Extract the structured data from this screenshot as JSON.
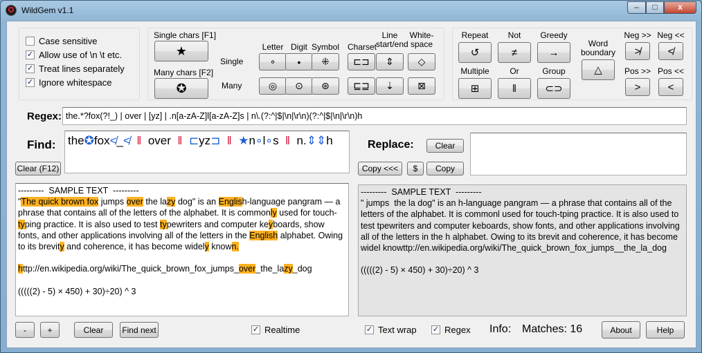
{
  "window": {
    "title": "WildGem v1.1",
    "app_icon": "✪"
  },
  "caption": {
    "minimize": "–",
    "maximize": "□",
    "close": "x"
  },
  "options": [
    {
      "label": "Case sensitive",
      "checked": false
    },
    {
      "label": "Allow use of \\n \\t etc.",
      "checked": true
    },
    {
      "label": "Treat lines separately",
      "checked": true
    },
    {
      "label": "Ignore whitespace",
      "checked": true
    }
  ],
  "chars": {
    "single_label": "Single chars [F1]",
    "single_glyph": "★",
    "many_label": "Many chars [F2]",
    "many_glyph": "✪",
    "row_single": "Single",
    "row_many": "Many",
    "columns": [
      {
        "label": "Letter",
        "single": "∘",
        "many": "◎"
      },
      {
        "label": "Digit",
        "single": "•",
        "many": "⊙"
      },
      {
        "label": "Symbol",
        "single": "⁜",
        "many": "⊛"
      },
      {
        "label": "Charset",
        "single": "⊏⊐",
        "many": "⊑⊒"
      },
      {
        "label": "Line\nstart/end",
        "single": "⇕",
        "many": "⇣"
      },
      {
        "label": "White-\nspace",
        "single": "◇",
        "many": "⊠"
      }
    ]
  },
  "ops": {
    "repeat": {
      "label": "Repeat",
      "glyph": "↺"
    },
    "not": {
      "label": "Not",
      "glyph": "≠"
    },
    "greedy": {
      "label": "Greedy",
      "glyph": "→"
    },
    "multiple": {
      "label": "Multiple",
      "glyph": "⊞"
    },
    "or": {
      "label": "Or",
      "glyph": "‖"
    },
    "group": {
      "label": "Group",
      "glyph": "⊂⊃"
    },
    "word_boundary": {
      "label": "Word\nboundary",
      "glyph": "△"
    },
    "neg_ahead": {
      "label": "Neg >>",
      "glyph": "≯"
    },
    "neg_behind": {
      "label": "Neg <<",
      "glyph": "≮"
    },
    "pos_ahead": {
      "label": "Pos >>",
      "glyph": ">"
    },
    "pos_behind": {
      "label": "Pos <<",
      "glyph": "<"
    }
  },
  "regex": {
    "label": "Regex:",
    "value": "the.*?fox(?!_)  |  over  |  [yz]  |  .n[a-zA-Z]l[a-zA-Z]s  |  n\\.(?:^|$|\\n|\\r\\n)(?:^|$|\\n|\\r\\n)h"
  },
  "find": {
    "label": "Find:",
    "clear_button": "Clear (F12)",
    "tokens": [
      {
        "text": "the",
        "cls": ""
      },
      {
        "text": "✪",
        "cls": "fk"
      },
      {
        "text": "fox",
        "cls": ""
      },
      {
        "text": "≮",
        "cls": "fk"
      },
      {
        "text": "_",
        "cls": ""
      },
      {
        "text": "≮",
        "cls": "fk"
      },
      {
        "text": "  ‖  ",
        "cls": "fr"
      },
      {
        "text": "over",
        "cls": ""
      },
      {
        "text": "  ‖  ",
        "cls": "fr"
      },
      {
        "text": "⊏",
        "cls": "fk"
      },
      {
        "text": "yz",
        "cls": ""
      },
      {
        "text": "⊐",
        "cls": "fk"
      },
      {
        "text": "  ‖  ",
        "cls": "fr"
      },
      {
        "text": "★",
        "cls": "fk"
      },
      {
        "text": "n",
        "cls": ""
      },
      {
        "text": "∘",
        "cls": "fk"
      },
      {
        "text": "l",
        "cls": ""
      },
      {
        "text": "∘",
        "cls": "fk"
      },
      {
        "text": "s",
        "cls": ""
      },
      {
        "text": "  ‖  ",
        "cls": "fr"
      },
      {
        "text": "n.",
        "cls": ""
      },
      {
        "text": "⇕⇕",
        "cls": "fk"
      },
      {
        "text": "h",
        "cls": ""
      }
    ]
  },
  "replace": {
    "label": "Replace:",
    "clear": "Clear",
    "copy_from": "Copy <<<",
    "dollar": "$",
    "copy": "Copy",
    "value": ""
  },
  "sample_left": [
    {
      "text": "---------  SAMPLE TEXT  ---------\n\"",
      "hl": false
    },
    {
      "text": "The quick brown fox",
      "hl": true
    },
    {
      "text": " jumps ",
      "hl": false
    },
    {
      "text": "over",
      "hl": true
    },
    {
      "text": " the la",
      "hl": false
    },
    {
      "text": "zy",
      "hl": true
    },
    {
      "text": " dog\" is an ",
      "hl": false
    },
    {
      "text": "Englis",
      "hl": true
    },
    {
      "text": "h-language pangram — a phrase that contains all of the letters of the alphabet. It is common",
      "hl": false
    },
    {
      "text": "ly",
      "hl": true
    },
    {
      "text": " used for touch-",
      "hl": false
    },
    {
      "text": "ty",
      "hl": true
    },
    {
      "text": "ping practice. It is also used to test ",
      "hl": false
    },
    {
      "text": "ty",
      "hl": true
    },
    {
      "text": "pewriters and computer ke",
      "hl": false
    },
    {
      "text": "y",
      "hl": true
    },
    {
      "text": "boards, show fonts, and other applications involving all of the letters in the ",
      "hl": false
    },
    {
      "text": "English",
      "hl": true
    },
    {
      "text": " alphabet. Owing to its brevit",
      "hl": false
    },
    {
      "text": "y",
      "hl": true
    },
    {
      "text": " and coherence, it has become widel",
      "hl": false
    },
    {
      "text": "y",
      "hl": true
    },
    {
      "text": " know",
      "hl": false
    },
    {
      "text": "n.",
      "hl": true
    },
    {
      "text": "\n\n",
      "hl": false
    },
    {
      "text": "h",
      "hl": true
    },
    {
      "text": "ttp://en.wikipedia.org/wiki/The_quick_brown_fox_jumps_",
      "hl": false
    },
    {
      "text": "over",
      "hl": true
    },
    {
      "text": "_the_la",
      "hl": false
    },
    {
      "text": "zy",
      "hl": true
    },
    {
      "text": "_dog\n\n(((((2) - 5) × 450) + 30)÷20) ^ 3",
      "hl": false
    }
  ],
  "sample_right": "---------  SAMPLE TEXT  ---------\n\" jumps  the la dog\" is an h-language pangram — a phrase that contains all of the letters of the alphabet. It is commonl used for touch-tping practice. It is also used to test tpewriters and computer keboards, show fonts, and other applications involving all of the letters in the h alphabet. Owing to its brevit and coherence, it has become widel knowttp://en.wikipedia.org/wiki/The_quick_brown_fox_jumps__the_la_dog\n\n(((((2) - 5) × 450) + 30)÷20) ^ 3",
  "bottom": {
    "minus": "-",
    "plus": "+",
    "clear": "Clear",
    "find_next": "Find next",
    "realtime": {
      "label": "Realtime",
      "checked": true
    },
    "text_wrap": {
      "label": "Text wrap",
      "checked": true
    },
    "regex_toggle": {
      "label": "Regex",
      "checked": true
    },
    "info_label": "Info:",
    "matches": "Matches: 16",
    "about": "About",
    "help": "Help"
  }
}
